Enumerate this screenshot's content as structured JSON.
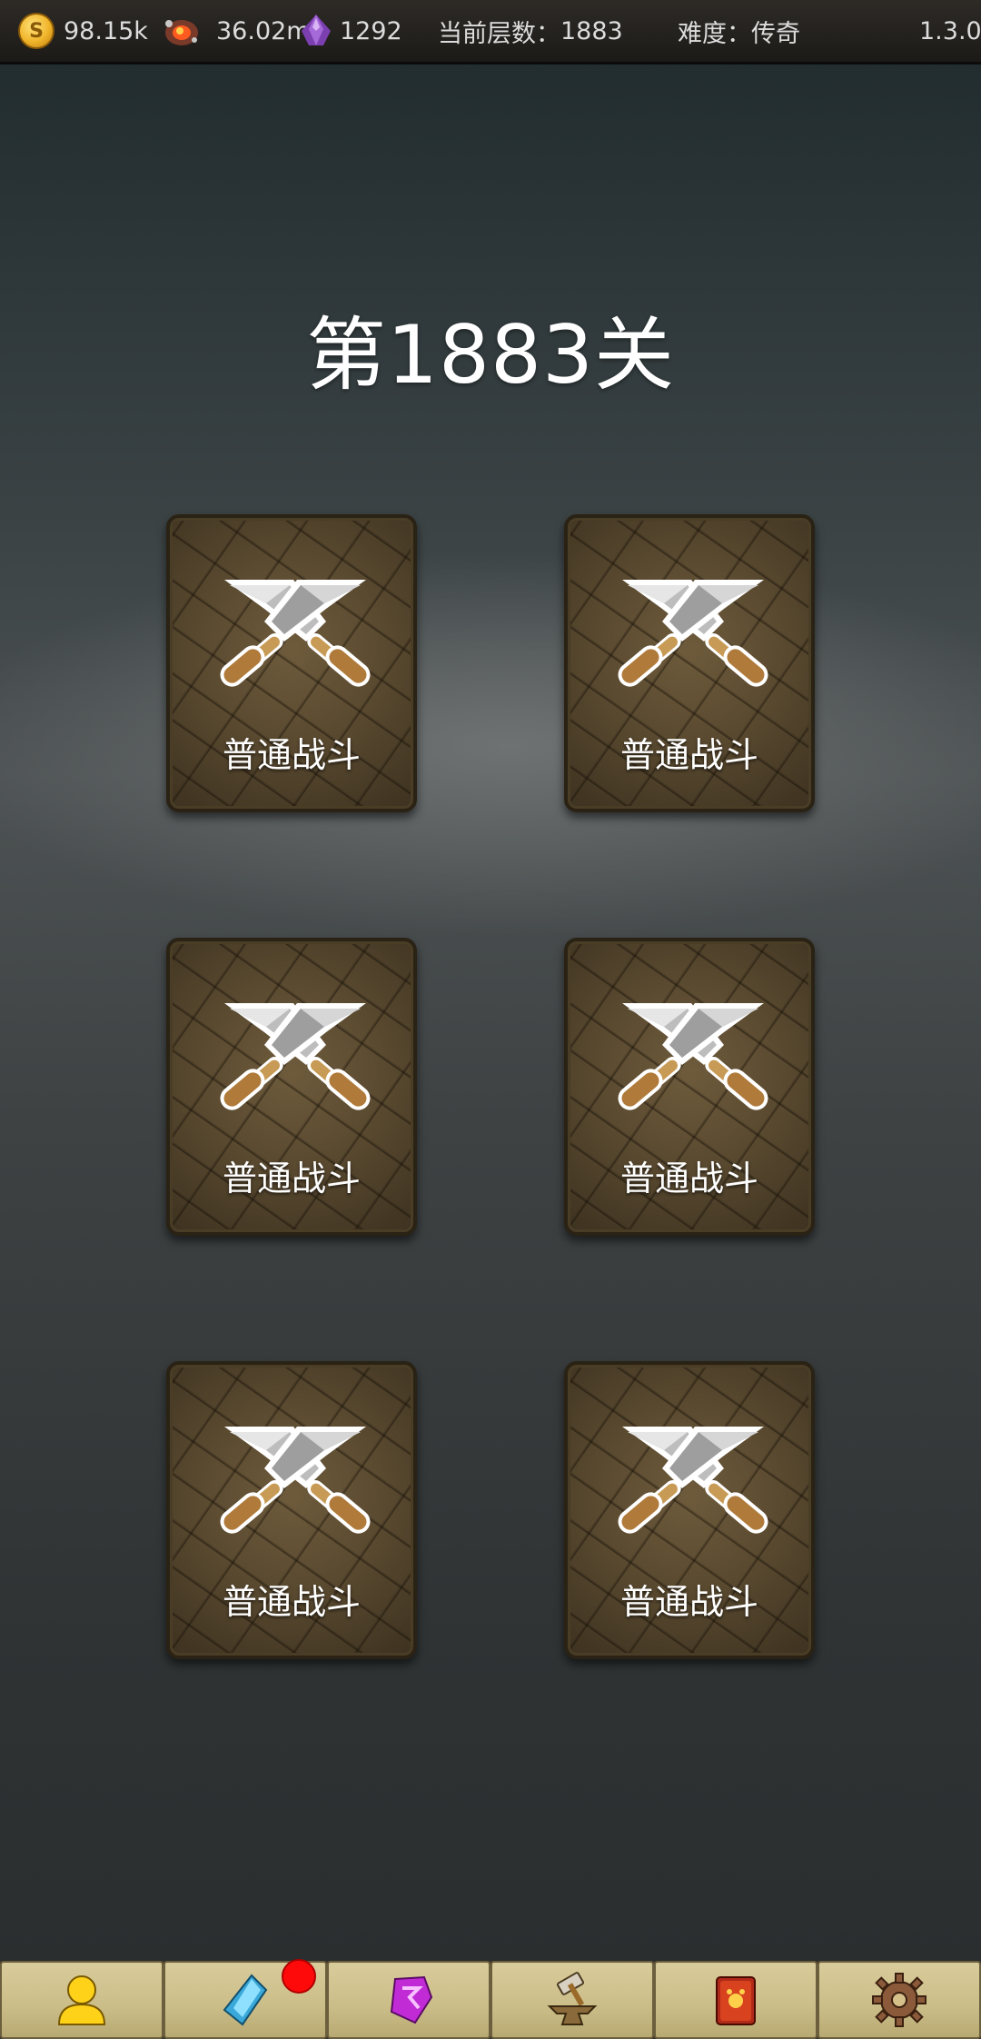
{
  "status_bar": {
    "gold": "98.15k",
    "ore": "36.02m",
    "gems": "1292",
    "floor_label": "当前层数：",
    "floor_value": "1883",
    "difficulty_label": "难度：",
    "difficulty_value": "传奇",
    "version": "1.3.0"
  },
  "level_title": "第1883关",
  "battles": [
    {
      "label": "普通战斗",
      "icon": "crossed-swords-icon"
    },
    {
      "label": "普通战斗",
      "icon": "crossed-swords-icon"
    },
    {
      "label": "普通战斗",
      "icon": "crossed-swords-icon"
    },
    {
      "label": "普通战斗",
      "icon": "crossed-swords-icon"
    },
    {
      "label": "普通战斗",
      "icon": "crossed-swords-icon"
    },
    {
      "label": "普通战斗",
      "icon": "crossed-swords-icon"
    }
  ],
  "bottom_nav": [
    {
      "icon": "hero-icon",
      "badge": false
    },
    {
      "icon": "crystal-icon",
      "badge": true
    },
    {
      "icon": "rune-icon",
      "badge": false
    },
    {
      "icon": "anvil-icon",
      "badge": false
    },
    {
      "icon": "book-icon",
      "badge": false
    },
    {
      "icon": "settings-gear-icon",
      "badge": false
    }
  ],
  "colors": {
    "badge_red": "#ff0a0a",
    "nav_bg": "#cbbd88",
    "card_brown": "#5a4a30"
  }
}
